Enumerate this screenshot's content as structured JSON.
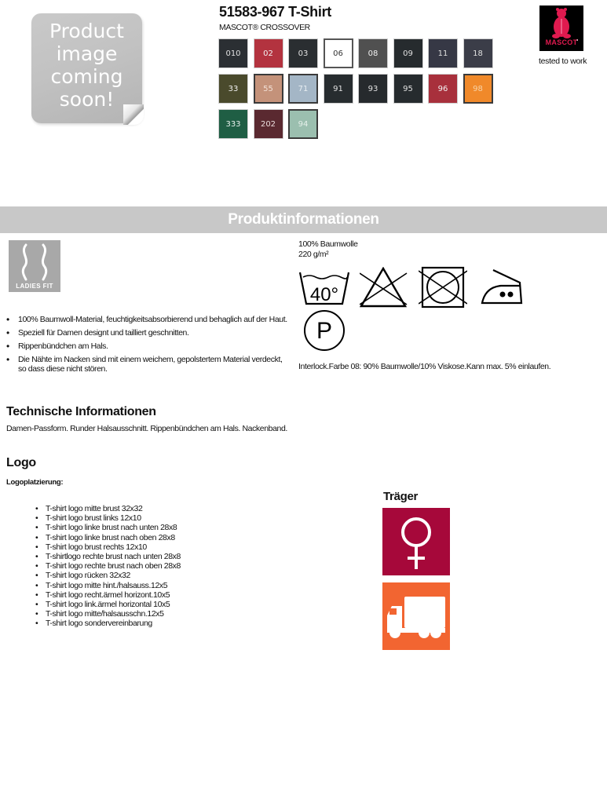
{
  "product": {
    "placeholder_lines": [
      "Product",
      "image",
      "coming",
      "soon!"
    ],
    "title": "51583-967 T-Shirt",
    "collection": "MASCOT® CROSSOVER"
  },
  "colors": [
    {
      "code": "010",
      "hex": "#2b2f33",
      "text": "#e0e0e0",
      "bordered": false
    },
    {
      "code": "02",
      "hex": "#b3333f",
      "text": "#f2f2f2",
      "bordered": false
    },
    {
      "code": "03",
      "hex": "#2a2e31",
      "text": "#e0e0e0",
      "bordered": false
    },
    {
      "code": "06",
      "hex": "#ffffff",
      "text": "#333333",
      "bordered": true
    },
    {
      "code": "08",
      "hex": "#505050",
      "text": "#f0f0f0",
      "bordered": false
    },
    {
      "code": "09",
      "hex": "#262b2e",
      "text": "#e0e0e0",
      "bordered": false
    },
    {
      "code": "11",
      "hex": "#363845",
      "text": "#e0e0e0",
      "bordered": false
    },
    {
      "code": "18",
      "hex": "#3b3d48",
      "text": "#e0e0e0",
      "bordered": false
    },
    {
      "code": "33",
      "hex": "#4a4a2c",
      "text": "#f0f0f0",
      "bordered": false
    },
    {
      "code": "55",
      "hex": "#c4927a",
      "text": "#f2e0d6",
      "bordered": true
    },
    {
      "code": "71",
      "hex": "#a4b6c6",
      "text": "#e8eef2",
      "bordered": true
    },
    {
      "code": "91",
      "hex": "#272c2f",
      "text": "#e0e0e0",
      "bordered": false
    },
    {
      "code": "93",
      "hex": "#262a2d",
      "text": "#e0e0e0",
      "bordered": false
    },
    {
      "code": "95",
      "hex": "#262b2e",
      "text": "#e0e0e0",
      "bordered": false
    },
    {
      "code": "96",
      "hex": "#a8303c",
      "text": "#f2f2f2",
      "bordered": false
    },
    {
      "code": "98",
      "hex": "#f0892a",
      "text": "#f7d2a6",
      "bordered": true
    },
    {
      "code": "333",
      "hex": "#1f5e44",
      "text": "#e8f0ec",
      "bordered": false
    },
    {
      "code": "202",
      "hex": "#5a2930",
      "text": "#eadcdc",
      "bordered": false
    },
    {
      "code": "94",
      "hex": "#9bbfaf",
      "text": "#e6f0ea",
      "bordered": true
    }
  ],
  "brand": {
    "name": "MASCOT",
    "tagline": "tested to work",
    "accent": "#e01a4f"
  },
  "banner": {
    "title": "Produktinformationen"
  },
  "fit_badge": {
    "label": "LADIES FIT"
  },
  "features": [
    "100% Baumwoll-Material, feuchtigkeitsabsorbierend und behaglich auf der Haut.",
    "Speziell für Damen designt und tailliert geschnitten.",
    "Rippenbündchen am Hals.",
    "Die Nähte im Nacken sind mit einem weichem, gepolstertem Material verdeckt, so dass diese nicht stören."
  ],
  "material": {
    "composition": "100% Baumwolle",
    "weight": "220 g/m²"
  },
  "care": {
    "wash_temp": "40°",
    "dryclean_letter": "P",
    "icons": [
      "wash-40-icon",
      "no-bleach-icon",
      "no-tumble-dry-icon",
      "iron-two-dots-icon",
      "dryclean-p-icon"
    ],
    "note": "Interlock.Farbe 08:  90% Baumwolle/10% Viskose.Kann max. 5% einlaufen."
  },
  "technical": {
    "heading": "Technische Informationen",
    "text": "Damen-Passform. Runder Halsausschnitt. Rippenbündchen am Hals. Nackenband."
  },
  "logo": {
    "heading": "Logo",
    "subheading": "Logoplatzierung:",
    "placements": [
      "T-shirt logo mitte brust 32x32",
      "T-shirt logo brust links 12x10",
      "T-shirt logo linke brust nach unten 28x8",
      "T-shirt logo linke brust nach oben 28x8",
      "T-shirt logo brust rechts 12x10",
      "T-shirtlogo rechte brust nach unten 28x8",
      "T-shirt logo rechte brust nach oben 28x8",
      "T-shirt logo rücken 32x32",
      "T-shirt logo mitte hint./halsauss.12x5",
      "T-shirt logo recht.ärmel horizont.10x5",
      "T-shirt logo link.ärmel horizontal 10x5",
      "T-shirt logo mitte/halsausschn.12x5",
      "T-shirt logo sondervereinbarung"
    ]
  },
  "traeger": {
    "heading": "Träger",
    "icons": [
      {
        "name": "female-icon",
        "bg": "#a6083a"
      },
      {
        "name": "truck-icon",
        "bg": "#f26531"
      }
    ]
  }
}
